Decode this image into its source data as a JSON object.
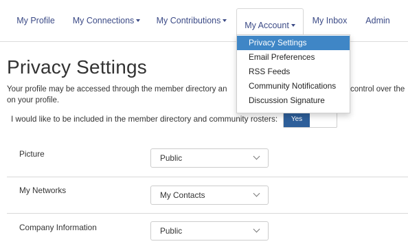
{
  "nav": {
    "items": [
      {
        "label": "My Profile",
        "has_caret": false
      },
      {
        "label": "My Connections",
        "has_caret": true
      },
      {
        "label": "My Contributions",
        "has_caret": true
      },
      {
        "label": "My Account",
        "has_caret": true,
        "open": true
      },
      {
        "label": "My Inbox",
        "has_caret": false
      },
      {
        "label": "Admin",
        "has_caret": false
      }
    ]
  },
  "account_menu": {
    "items": [
      {
        "label": "Privacy Settings",
        "active": true
      },
      {
        "label": "Email Preferences"
      },
      {
        "label": "RSS Feeds"
      },
      {
        "label": "Community Notifications"
      },
      {
        "label": "Discussion Signature"
      }
    ]
  },
  "page": {
    "title": "Privacy Settings",
    "intro_line1_start": "Your profile may be accessed through the member directory an",
    "intro_line1_end": "control over the",
    "intro_line2": "on your profile.",
    "directory_option": {
      "label": "I would like to be included in the member directory and community rosters:",
      "value": "Yes"
    }
  },
  "settings": [
    {
      "label": "Picture",
      "value": "Public"
    },
    {
      "label": "My Networks",
      "value": "My Contacts"
    },
    {
      "label": "Company Information",
      "value": "Public"
    }
  ],
  "colors": {
    "nav_text": "#3b4a86",
    "menu_active": "#3f86c6",
    "toggle_on": "#2e5f9a"
  }
}
